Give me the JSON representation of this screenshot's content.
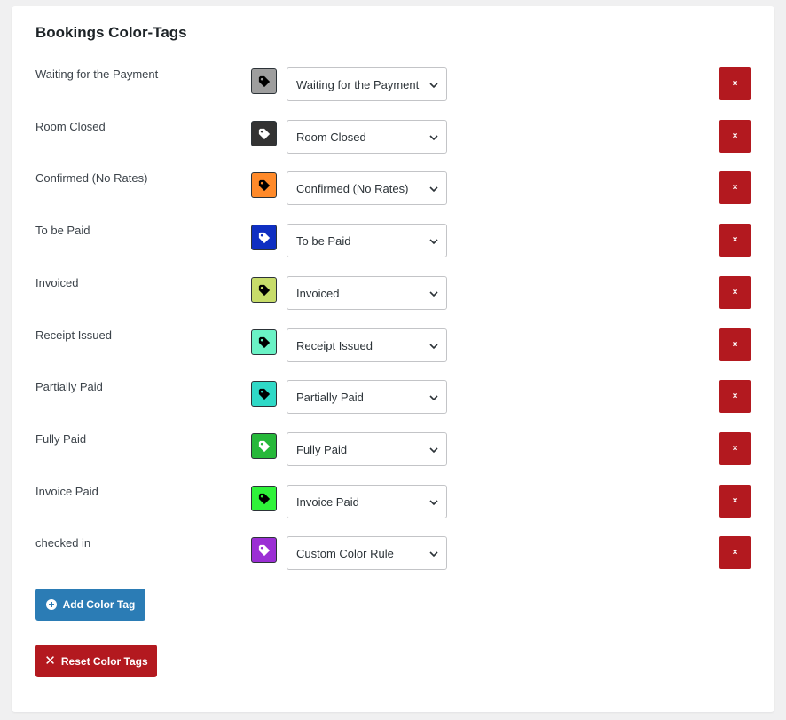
{
  "panel": {
    "title": "Bookings Color-Tags"
  },
  "rows": [
    {
      "label": "Waiting for the Payment",
      "selected": "Waiting for the Payment",
      "color": "#9e9e9e",
      "icon_color": "#000000",
      "delete_label": "×"
    },
    {
      "label": "Room Closed",
      "selected": "Room Closed",
      "color": "#333333",
      "icon_color": "#ffffff",
      "delete_label": "×"
    },
    {
      "label": "Confirmed (No Rates)",
      "selected": "Confirmed (No Rates)",
      "color": "#ff8a2a",
      "icon_color": "#000000",
      "delete_label": "×"
    },
    {
      "label": "To be Paid",
      "selected": "To be Paid",
      "color": "#0f2fc2",
      "icon_color": "#ffffff",
      "delete_label": "×"
    },
    {
      "label": "Invoiced",
      "selected": "Invoiced",
      "color": "#c7dc6a",
      "icon_color": "#000000",
      "delete_label": "×"
    },
    {
      "label": "Receipt Issued",
      "selected": "Receipt Issued",
      "color": "#6af2c5",
      "icon_color": "#000000",
      "delete_label": "×"
    },
    {
      "label": "Partially Paid",
      "selected": "Partially Paid",
      "color": "#2fd9c7",
      "icon_color": "#000000",
      "delete_label": "×"
    },
    {
      "label": "Fully Paid",
      "selected": "Fully Paid",
      "color": "#26b83a",
      "icon_color": "#ffffff",
      "delete_label": "×"
    },
    {
      "label": "Invoice Paid",
      "selected": "Invoice Paid",
      "color": "#2ff23a",
      "icon_color": "#000000",
      "delete_label": "×"
    },
    {
      "label": "checked in",
      "selected": "Custom Color Rule",
      "color": "#9b2fd4",
      "icon_color": "#ffffff",
      "delete_label": "×"
    }
  ],
  "buttons": {
    "add_label": "Add Color Tag",
    "reset_label": "Reset Color Tags",
    "add_icon": "plus-circle-icon",
    "reset_icon": "close-icon"
  },
  "colors": {
    "accent_blue": "#2b7cb5",
    "danger_red": "#b3191f"
  }
}
